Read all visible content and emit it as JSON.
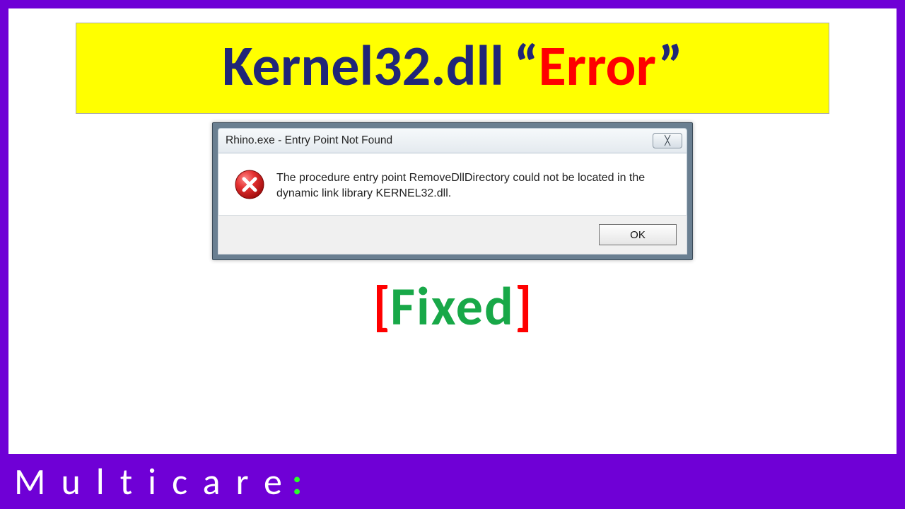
{
  "headline": {
    "main": "Kernel32.dll",
    "quote_open": "“",
    "error": "Error",
    "quote_close": "”"
  },
  "dialog": {
    "title": "Rhino.exe - Entry Point Not Found",
    "close_glyph": "╳",
    "message": "The procedure entry point RemoveDllDirectory could not be located in the dynamic link library KERNEL32.dll.",
    "ok_label": "OK"
  },
  "fixed": {
    "open": "[",
    "word": "Fixed",
    "close": "]"
  },
  "footer": {
    "brand": "Multicare",
    "colon": ":"
  }
}
